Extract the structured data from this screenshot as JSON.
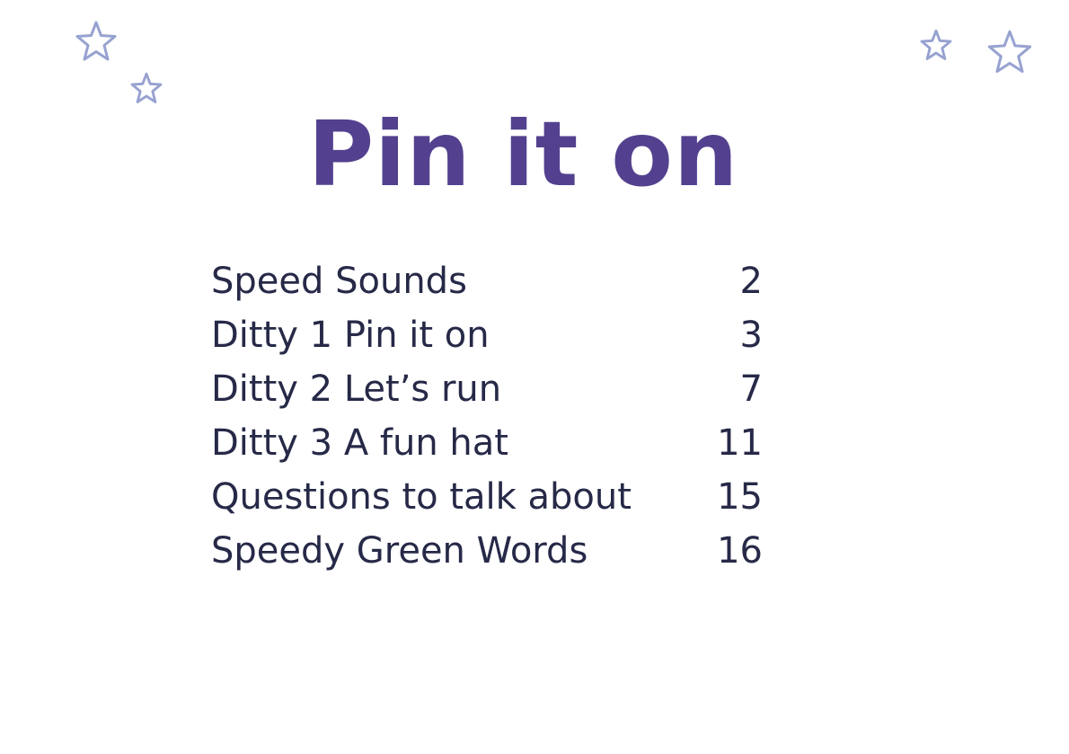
{
  "colors": {
    "title": "#53418f",
    "text": "#262947",
    "star_outline": "#97a2d0"
  },
  "decorations": {
    "stars": [
      "star-icon",
      "star-icon",
      "star-icon",
      "star-icon"
    ]
  },
  "page": {
    "title": "Pin it on"
  },
  "toc": {
    "entries": [
      {
        "label": "Speed Sounds",
        "page": "2"
      },
      {
        "label": "Ditty 1 Pin it on",
        "page": "3"
      },
      {
        "label": "Ditty 2 Let’s run",
        "page": "7"
      },
      {
        "label": "Ditty 3 A fun hat",
        "page": "11"
      },
      {
        "label": "Questions to talk about",
        "page": "15"
      },
      {
        "label": "Speedy Green Words",
        "page": "16"
      }
    ]
  }
}
